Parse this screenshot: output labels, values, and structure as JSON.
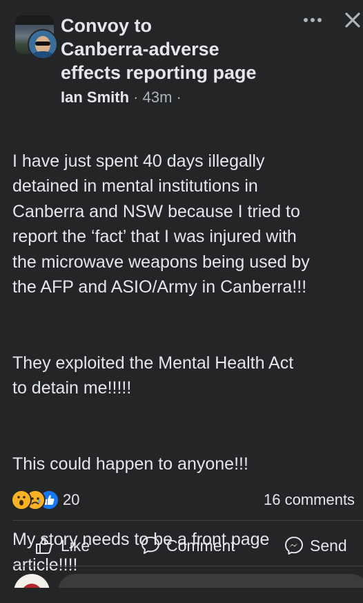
{
  "post": {
    "group_title_lines": [
      "Convoy to",
      "Canberra-adverse",
      "effects reporting page"
    ],
    "author": "Ian Smith",
    "separator": "·",
    "time": "43m",
    "trailing_separator": "·",
    "body_paragraphs": [
      "I have just spent 40 days illegally\ndetained in mental institutions in\nCanberra and NSW because I tried to\nreport the ‘fact’ that I was injured with\nthe microwave weapons being used by\nthe AFP and ASIO/Army in Canberra!!!",
      "They exploited the Mental Health Act\nto detain me!!!!!",
      "This could happen to anyone!!!",
      "My story needs to be a front page\narticle!!!!"
    ]
  },
  "stats": {
    "reaction_icons": [
      "wow-emoji",
      "sad-emoji",
      "like-thumb"
    ],
    "reaction_count": "20",
    "comments_label": "16 comments"
  },
  "actions": {
    "like": "Like",
    "comment": "Comment",
    "send": "Send"
  },
  "icons": {
    "more": "more-horizontal-icon",
    "close": "close-icon",
    "like": "thumbs-up-icon",
    "comment": "speech-bubble-icon",
    "send": "messenger-icon"
  },
  "colors": {
    "background": "#242526",
    "text": "#e4e6eb",
    "secondary_text": "#b0b3b8",
    "like_blue": "#1877f2",
    "emoji_yellow": "#f7b125"
  }
}
